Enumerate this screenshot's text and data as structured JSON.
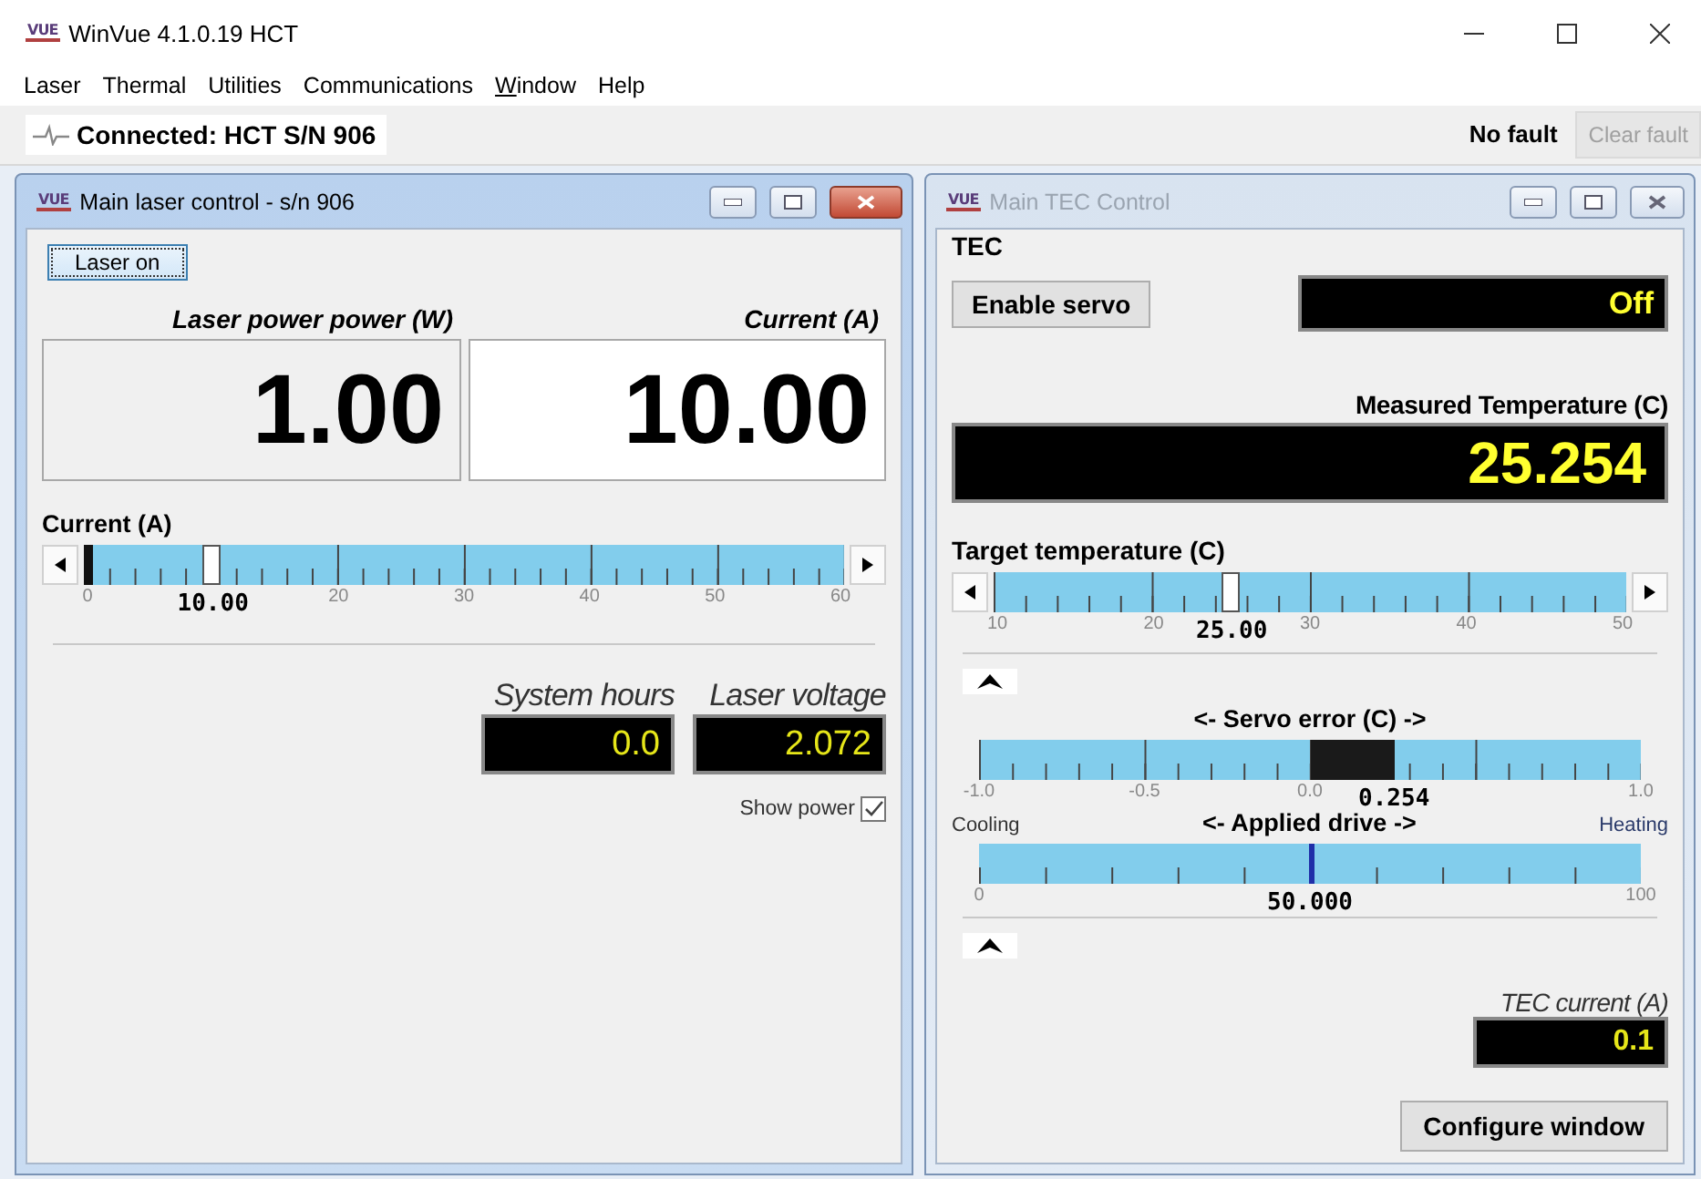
{
  "app": {
    "logo": "VUE",
    "title": "WinVue 4.1.0.19 HCT"
  },
  "menu": [
    {
      "label": "Laser",
      "underlined": false
    },
    {
      "label": "Thermal",
      "underlined": false
    },
    {
      "label": "Utilities",
      "underlined": false
    },
    {
      "label": "Communications",
      "underlined": false
    },
    {
      "label": "Window",
      "underlined": true
    },
    {
      "label": "Help",
      "underlined": false
    }
  ],
  "status_bar": {
    "connection": "Connected: HCT S/N 906",
    "fault": "No fault",
    "clear_fault": {
      "label": "Clear fault",
      "disabled": true
    }
  },
  "laser_window": {
    "logo": "VUE",
    "title": "Main laser control  - s/n 906",
    "active": true,
    "laser_button": "Laser on",
    "displays": [
      {
        "label": "Laser power power (W)",
        "value": "1.00",
        "editable": false
      },
      {
        "label": "Current (A)",
        "value": "10.00",
        "editable": true
      }
    ],
    "current_slider": {
      "label": "Current (A)",
      "level": 0.1667,
      "reading": "10.00",
      "scale": [
        "0",
        "20",
        "30",
        "40",
        "50",
        "60"
      ]
    },
    "readouts": [
      {
        "label": "System hours",
        "value": "0.0"
      },
      {
        "label": "Laser voltage",
        "value": "2.072"
      }
    ],
    "show_power": {
      "label": "Show power",
      "checked": true
    }
  },
  "tec_window": {
    "logo": "VUE",
    "title": "Main TEC Control",
    "active": false,
    "group": "TEC",
    "servo_button": "Enable servo",
    "servo_state": "Off",
    "measured": {
      "label": "Measured Temperature (C)",
      "value": "25.254"
    },
    "target_slider": {
      "label": "Target temperature (C)",
      "level": 0.375,
      "reading": "25.00",
      "scale": [
        "10",
        "20",
        "30",
        "40",
        "50"
      ]
    },
    "servo_error": {
      "label": "<- Servo error (C) ->",
      "level": 0.627,
      "reading": "0.254",
      "scale": [
        "-1.0",
        "-0.5",
        "0.0",
        "1.0"
      ]
    },
    "drive": {
      "label": "<- Applied drive ->",
      "left": "Cooling",
      "right": "Heating",
      "level": 0.5,
      "reading": "50.000",
      "scale": [
        "0",
        "100"
      ]
    },
    "tec_current": {
      "label": "TEC current (A)",
      "value": "0.1"
    },
    "configure_button": "Configure window"
  }
}
